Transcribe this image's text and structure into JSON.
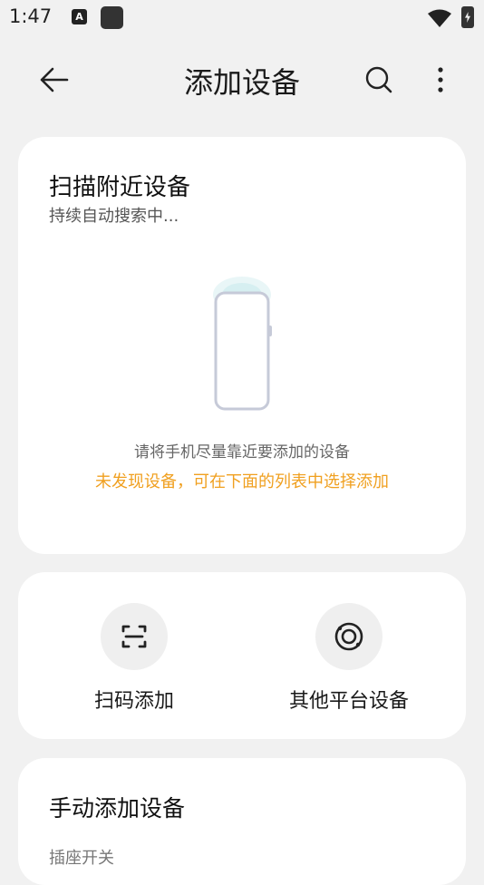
{
  "status_bar": {
    "time": "1:47",
    "a_icon_label": "A"
  },
  "header": {
    "title": "添加设备"
  },
  "scan_card": {
    "title": "扫描附近设备",
    "subtitle": "持续自动搜索中...",
    "hint": "请将手机尽量靠近要添加的设备",
    "warning": "未发现设备，可在下面的列表中选择添加",
    "warning_color": "#f0a020"
  },
  "actions": [
    {
      "label": "扫码添加",
      "icon": "scan-qr-icon"
    },
    {
      "label": "其他平台设备",
      "icon": "other-platform-icon"
    }
  ],
  "manual_card": {
    "title": "手动添加设备",
    "first_item": "插座开关"
  }
}
